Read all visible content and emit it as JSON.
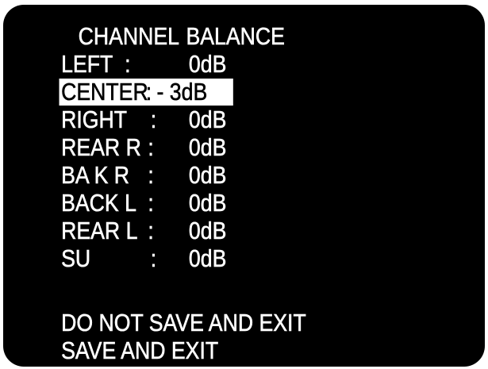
{
  "menu": {
    "title_word_1": "CHANNEL",
    "title_word_2": "BALANCE",
    "rows": [
      {
        "label": "LEFT",
        "sep": ":",
        "value": "0dB",
        "selected": false
      },
      {
        "label": "CENTER",
        "sep": ":",
        "value": "- 3dB",
        "selected": true
      },
      {
        "label": "RIGHT",
        "sep": ":",
        "value": "0dB",
        "selected": false
      },
      {
        "label": "REAR R",
        "sep": ":",
        "value": "0dB",
        "selected": false
      },
      {
        "label": "BA K R",
        "sep": ":",
        "value": "0dB",
        "selected": false
      },
      {
        "label": "BACK L",
        "sep": ":",
        "value": "0dB",
        "selected": false
      },
      {
        "label": "REAR L",
        "sep": ":",
        "value": "0dB",
        "selected": false
      },
      {
        "label": "SU",
        "sep": ":",
        "value": "0dB",
        "selected": false
      }
    ],
    "actions": [
      {
        "label": "DO NOT SAVE AND EXIT"
      },
      {
        "label": "SAVE AND EXIT"
      }
    ]
  },
  "colors": {
    "background": "#000000",
    "text": "#ffffff",
    "highlight": "#ffffff",
    "highlight_text": "#000000"
  }
}
